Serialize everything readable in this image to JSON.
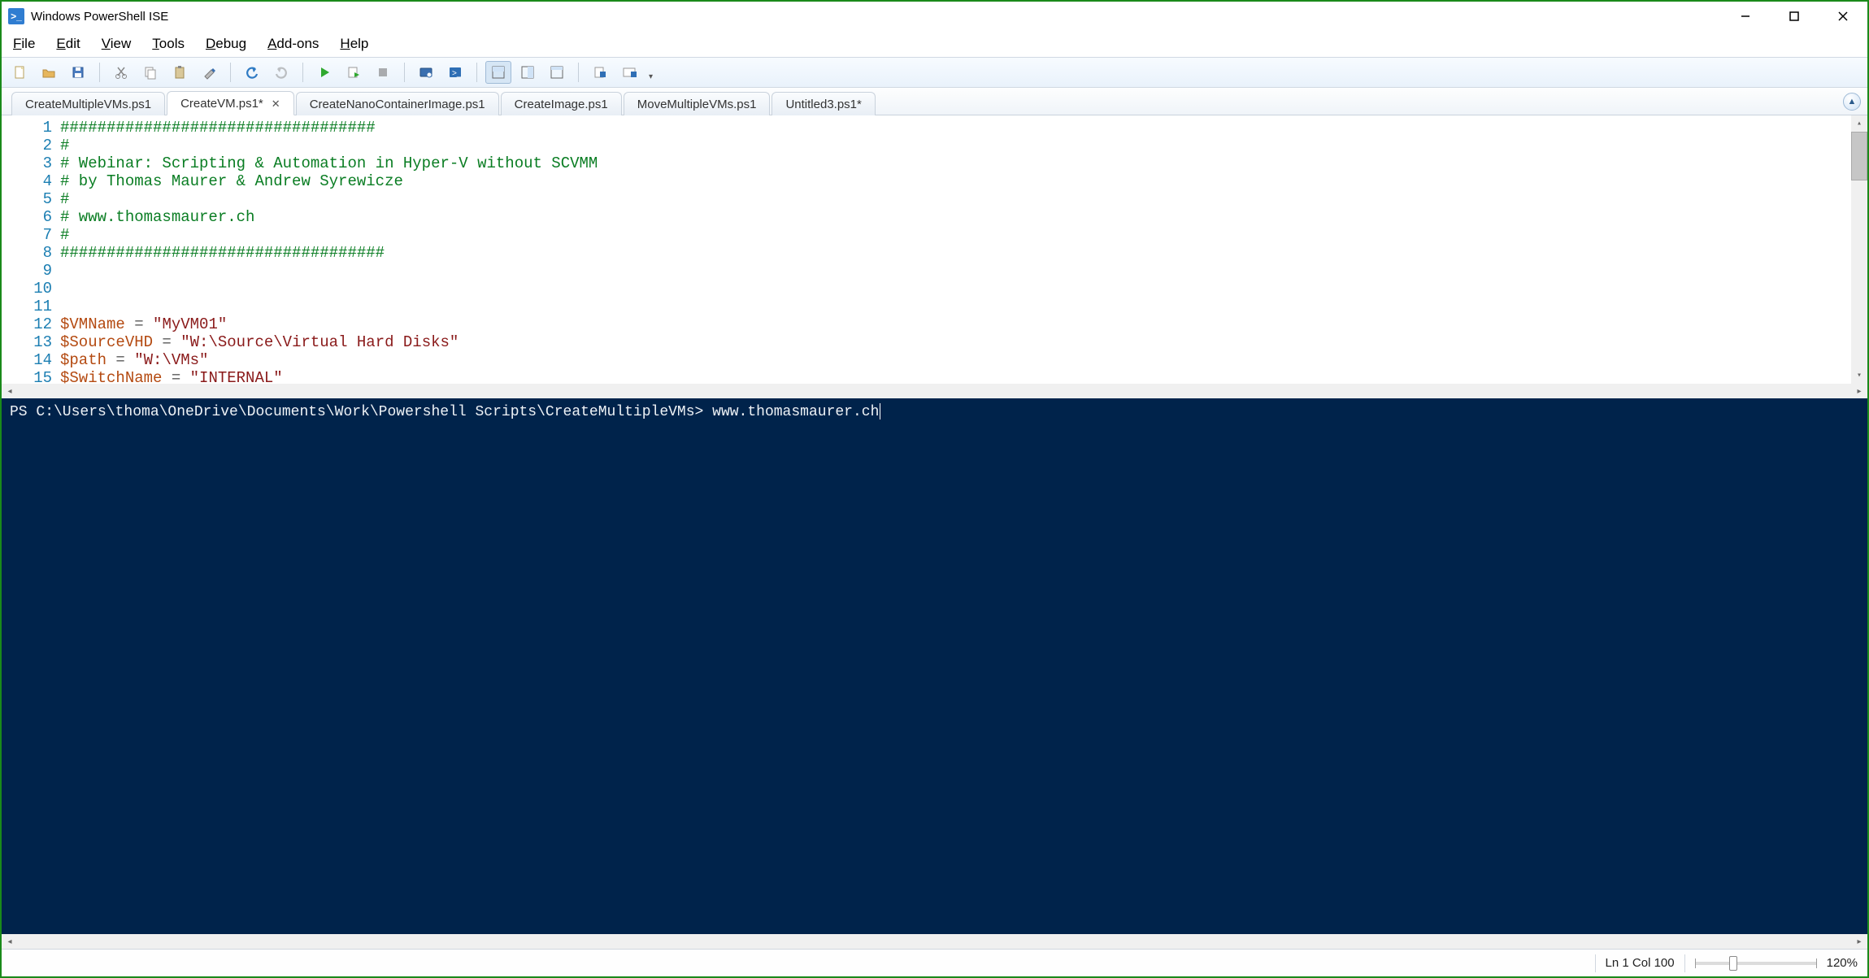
{
  "titlebar": {
    "app_title": "Windows PowerShell ISE"
  },
  "menu": {
    "file": {
      "label": "File",
      "accel": "F"
    },
    "edit": {
      "label": "Edit",
      "accel": "E"
    },
    "view": {
      "label": "View",
      "accel": "V"
    },
    "tools": {
      "label": "Tools",
      "accel": "T"
    },
    "debug": {
      "label": "Debug",
      "accel": "D"
    },
    "addons": {
      "label": "Add-ons",
      "accel": "A"
    },
    "help": {
      "label": "Help",
      "accel": "H"
    }
  },
  "tabs": [
    {
      "label": "CreateMultipleVMs.ps1",
      "active": false,
      "dirty": false
    },
    {
      "label": "CreateVM.ps1*",
      "active": true,
      "dirty": true
    },
    {
      "label": "CreateNanoContainerImage.ps1",
      "active": false,
      "dirty": false
    },
    {
      "label": "CreateImage.ps1",
      "active": false,
      "dirty": false
    },
    {
      "label": "MoveMultipleVMs.ps1",
      "active": false,
      "dirty": false
    },
    {
      "label": "Untitled3.ps1*",
      "active": false,
      "dirty": true
    }
  ],
  "editor": {
    "lines": [
      {
        "n": 1,
        "tokens": [
          {
            "t": "##################################",
            "c": "comment"
          }
        ]
      },
      {
        "n": 2,
        "tokens": [
          {
            "t": "#",
            "c": "comment"
          }
        ]
      },
      {
        "n": 3,
        "tokens": [
          {
            "t": "# Webinar: Scripting & Automation in Hyper-V without SCVMM",
            "c": "comment"
          }
        ]
      },
      {
        "n": 4,
        "tokens": [
          {
            "t": "# by Thomas Maurer & Andrew Syrewicze",
            "c": "comment"
          }
        ]
      },
      {
        "n": 5,
        "tokens": [
          {
            "t": "#",
            "c": "comment"
          }
        ]
      },
      {
        "n": 6,
        "tokens": [
          {
            "t": "# www.thomasmaurer.ch",
            "c": "comment"
          }
        ]
      },
      {
        "n": 7,
        "tokens": [
          {
            "t": "#",
            "c": "comment"
          }
        ]
      },
      {
        "n": 8,
        "tokens": [
          {
            "t": "###################################",
            "c": "comment"
          }
        ]
      },
      {
        "n": 9,
        "tokens": []
      },
      {
        "n": 10,
        "tokens": []
      },
      {
        "n": 11,
        "tokens": []
      },
      {
        "n": 12,
        "tokens": [
          {
            "t": "$VMName",
            "c": "var"
          },
          {
            "t": " = ",
            "c": "op"
          },
          {
            "t": "\"MyVM01\"",
            "c": "str"
          }
        ]
      },
      {
        "n": 13,
        "tokens": [
          {
            "t": "$SourceVHD",
            "c": "var"
          },
          {
            "t": " = ",
            "c": "op"
          },
          {
            "t": "\"W:\\Source\\Virtual Hard Disks\"",
            "c": "str"
          }
        ]
      },
      {
        "n": 14,
        "tokens": [
          {
            "t": "$path",
            "c": "var"
          },
          {
            "t": " = ",
            "c": "op"
          },
          {
            "t": "\"W:\\VMs\"",
            "c": "str"
          }
        ]
      },
      {
        "n": 15,
        "tokens": [
          {
            "t": "$SwitchName",
            "c": "var"
          },
          {
            "t": " = ",
            "c": "op"
          },
          {
            "t": "\"INTERNAL\"",
            "c": "str"
          }
        ]
      }
    ]
  },
  "console": {
    "prompt": "PS C:\\Users\\thoma\\OneDrive\\Documents\\Work\\Powershell Scripts\\CreateMultipleVMs> ",
    "input": "www.thomasmaurer.ch"
  },
  "status": {
    "position": "Ln 1  Col 100",
    "zoom": "120%"
  }
}
